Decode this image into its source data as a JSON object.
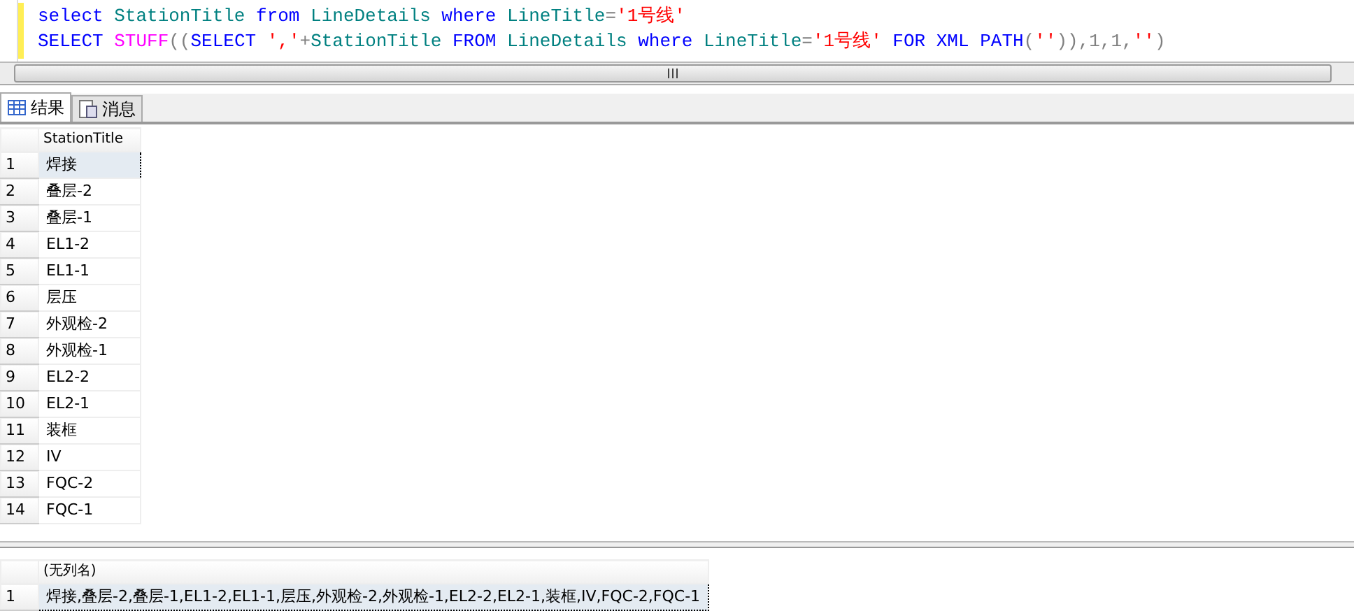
{
  "editor": {
    "lines": [
      [
        {
          "kind": "keyword",
          "text": "select"
        },
        {
          "kind": "identifier",
          "text": " StationTitle "
        },
        {
          "kind": "keyword",
          "text": "from"
        },
        {
          "kind": "identifier",
          "text": " LineDetails "
        },
        {
          "kind": "keyword",
          "text": "where"
        },
        {
          "kind": "identifier",
          "text": " LineTitle"
        },
        {
          "kind": "operator",
          "text": "="
        },
        {
          "kind": "string",
          "text": "'1号线'"
        }
      ],
      [
        {
          "kind": "keyword",
          "text": "SELECT "
        },
        {
          "kind": "function",
          "text": "STUFF"
        },
        {
          "kind": "operator",
          "text": "(("
        },
        {
          "kind": "keyword",
          "text": "SELECT "
        },
        {
          "kind": "string",
          "text": "','"
        },
        {
          "kind": "operator",
          "text": "+"
        },
        {
          "kind": "identifier",
          "text": "StationTitle "
        },
        {
          "kind": "keyword",
          "text": "FROM"
        },
        {
          "kind": "identifier",
          "text": " LineDetails "
        },
        {
          "kind": "keyword",
          "text": "where"
        },
        {
          "kind": "identifier",
          "text": " LineTitle"
        },
        {
          "kind": "operator",
          "text": "="
        },
        {
          "kind": "string",
          "text": "'1号线'"
        },
        {
          "kind": "keyword",
          "text": " FOR XML PATH"
        },
        {
          "kind": "operator",
          "text": "("
        },
        {
          "kind": "string",
          "text": "''"
        },
        {
          "kind": "operator",
          "text": ")),1,1,"
        },
        {
          "kind": "string",
          "text": "''"
        },
        {
          "kind": "operator",
          "text": ")"
        }
      ]
    ]
  },
  "tabs": [
    {
      "label": "结果",
      "kind": "grid",
      "selected": true
    },
    {
      "label": "消息",
      "kind": "messages",
      "selected": false
    }
  ],
  "results": [
    {
      "columns": [
        "StationTitle"
      ],
      "rows": [
        {
          "number": "1",
          "cells": [
            "焊接"
          ],
          "selected": true
        },
        {
          "number": "2",
          "cells": [
            "叠层-2"
          ],
          "selected": false
        },
        {
          "number": "3",
          "cells": [
            "叠层-1"
          ],
          "selected": false
        },
        {
          "number": "4",
          "cells": [
            "EL1-2"
          ],
          "selected": false
        },
        {
          "number": "5",
          "cells": [
            "EL1-1"
          ],
          "selected": false
        },
        {
          "number": "6",
          "cells": [
            "层压"
          ],
          "selected": false
        },
        {
          "number": "7",
          "cells": [
            "外观检-2"
          ],
          "selected": false
        },
        {
          "number": "8",
          "cells": [
            "外观检-1"
          ],
          "selected": false
        },
        {
          "number": "9",
          "cells": [
            "EL2-2"
          ],
          "selected": false
        },
        {
          "number": "10",
          "cells": [
            "EL2-1"
          ],
          "selected": false
        },
        {
          "number": "11",
          "cells": [
            "装框"
          ],
          "selected": false
        },
        {
          "number": "12",
          "cells": [
            "IV"
          ],
          "selected": false
        },
        {
          "number": "13",
          "cells": [
            "FQC-2"
          ],
          "selected": false
        },
        {
          "number": "14",
          "cells": [
            "FQC-1"
          ],
          "selected": false
        }
      ]
    },
    {
      "columns": [
        "(无列名)"
      ],
      "rows": [
        {
          "number": "1",
          "cells": [
            "焊接,叠层-2,叠层-1,EL1-2,EL1-1,层压,外观检-2,外观检-1,EL2-2,EL2-1,装框,IV,FQC-2,FQC-1"
          ],
          "selected": true
        }
      ]
    }
  ]
}
